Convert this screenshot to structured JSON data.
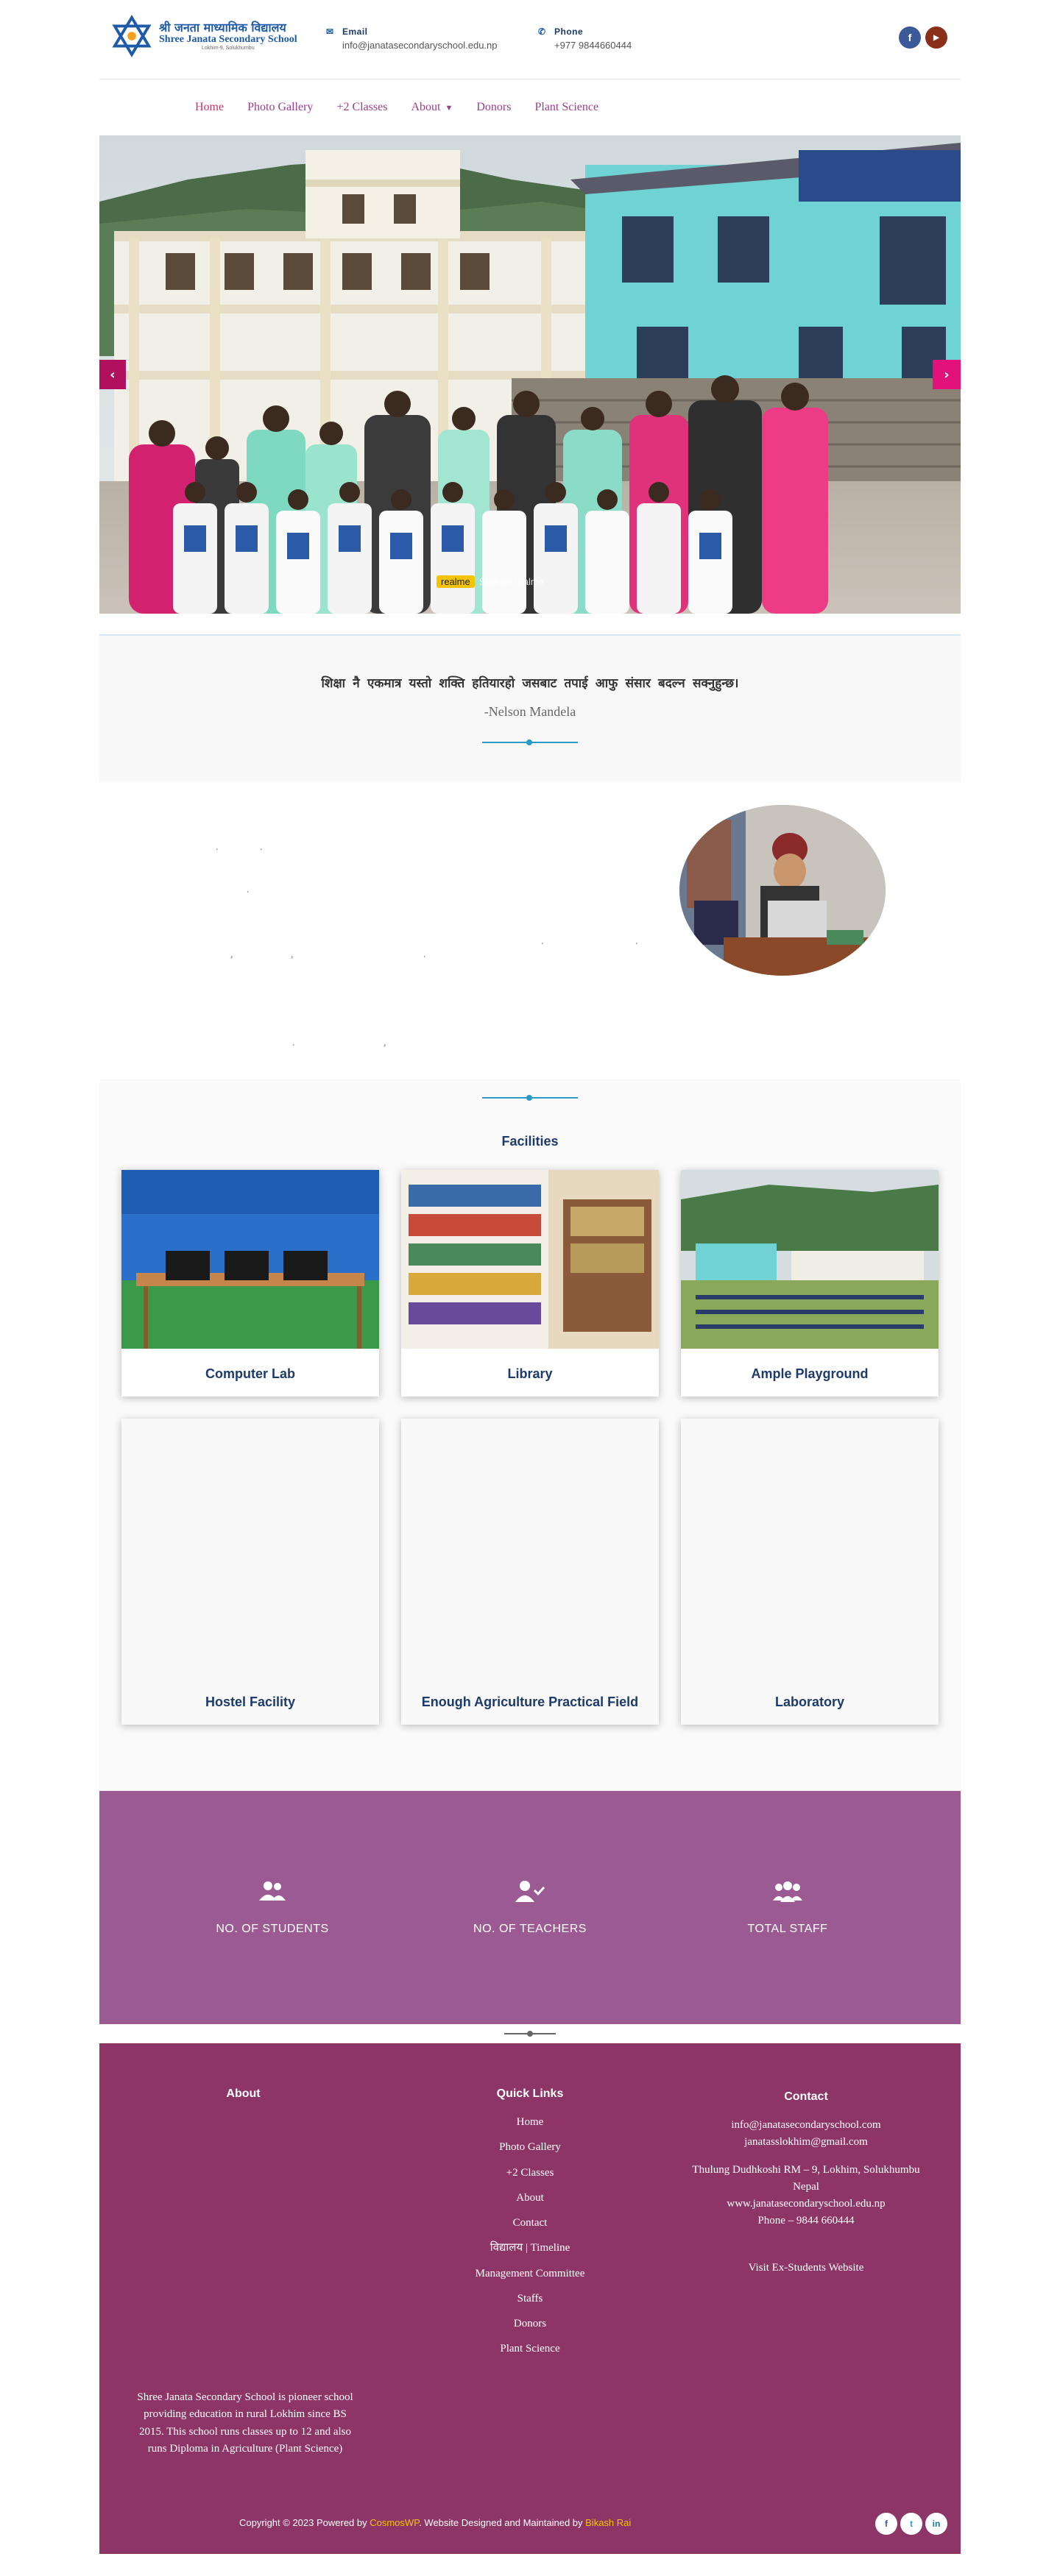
{
  "header": {
    "logo": {
      "line1": "श्री जनता माध्यामिक विद्यालय",
      "line2": "Shree Janata Secondary School",
      "line3": "Lokhim-9, Solukhumbu"
    },
    "email": {
      "label": "Email",
      "value": "info@janatasecondaryschool.edu.np",
      "icon": "envelope-icon"
    },
    "phone": {
      "label": "Phone",
      "value": "+977 9844660444",
      "icon": "phone-icon"
    },
    "socials": [
      {
        "name": "facebook",
        "glyph": "f",
        "color": "#3b5998"
      },
      {
        "name": "youtube",
        "glyph": "▶",
        "color": "#8b2e1a"
      }
    ]
  },
  "nav": {
    "items": [
      "Home",
      "Photo Gallery",
      "+2 Classes",
      "About",
      "Donors",
      "Plant Science"
    ]
  },
  "hero": {
    "watermark_brand": "realme",
    "watermark_caption": "Shot on realme"
  },
  "quote": {
    "text": "शिक्षा नै एकमात्र यस्तो शक्ति हतियारहो जसबाट तपाई आफु संसार बदल्न सक्नुहुन्छ। ",
    "author": "-Nelson Mandela"
  },
  "principal": {
    "dots": [
      ".",
      ".",
      ",",
      ",",
      ".",
      ".",
      ".",
      ".",
      ",",
      "."
    ]
  },
  "facilities": {
    "title": "Facilities",
    "cards": [
      "Computer Lab",
      "Library",
      "Ample Playground",
      "Hostel Facility",
      "Enough Agriculture Practical Field",
      "Laboratory"
    ]
  },
  "stats": [
    {
      "label": "NO. OF STUDENTS",
      "icon": "users-icon"
    },
    {
      "label": "NO. OF TEACHERS",
      "icon": "user-check-icon"
    },
    {
      "label": "TOTAL STAFF",
      "icon": "group-icon"
    }
  ],
  "footer": {
    "about": {
      "heading": "About",
      "text": "Shree Janata Secondary School is pioneer school providing education in rural Lokhim since BS 2015. This school runs classes up to 12 and also runs Diploma in Agriculture (Plant Science)"
    },
    "quick_links": {
      "heading": "Quick Links",
      "items": [
        "Home",
        "Photo Gallery",
        "+2 Classes",
        "About",
        "Contact",
        "विद्यालय | Timeline",
        "Management Committee",
        "Staffs",
        "Donors",
        "Plant Science"
      ]
    },
    "contact": {
      "heading": "Contact",
      "email1": "info@janatasecondaryschool.com",
      "email2": "janatasslokhim@gmail.com",
      "address1": "Thulung Dudhkoshi  RM – 9, Lokhim, Solukhumbu",
      "address2": "Nepal",
      "website": "www.janatasecondaryschool.edu.np",
      "phone": "Phone – 9844 660444",
      "ex_students": "Visit Ex-Students Website"
    },
    "copyright_prefix": "Copyright © 2023 Powered by ",
    "copyright_brand": "CosmosWP",
    "copyright_mid": ". Website Designed and Maintained by ",
    "copyright_author": "Bikash Rai",
    "socials": [
      {
        "name": "facebook",
        "glyph": "f",
        "color": "#3b5998"
      },
      {
        "name": "twitter",
        "glyph": "t",
        "color": "#1da1f2"
      },
      {
        "name": "linkedin",
        "glyph": "in",
        "color": "#0e76a8"
      }
    ]
  }
}
